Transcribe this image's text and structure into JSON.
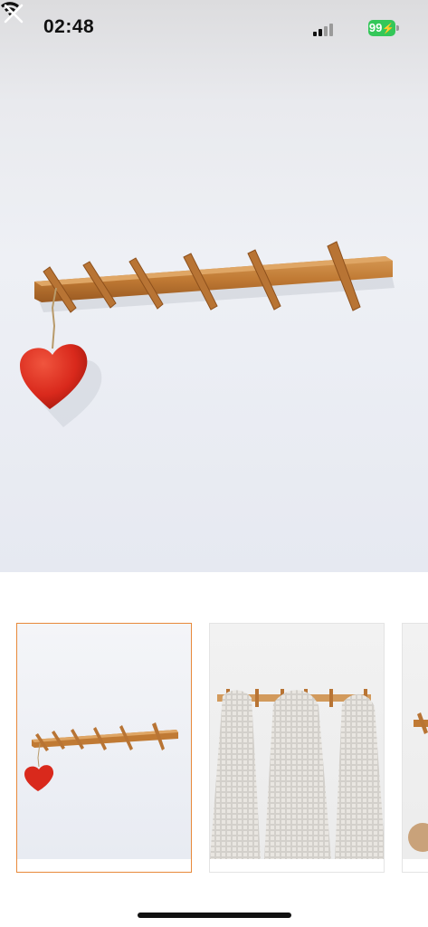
{
  "status_bar": {
    "time": "02:48",
    "battery": "99"
  },
  "icons": {
    "close": "close-icon",
    "signal": "cellular-signal-icon",
    "wifi": "wifi-icon",
    "battery": "battery-icon"
  },
  "gallery": {
    "main_image": "product-photo-1",
    "thumbnails": [
      {
        "id": "thumb-1",
        "selected": true
      },
      {
        "id": "thumb-2",
        "selected": false
      },
      {
        "id": "thumb-3",
        "selected": false
      }
    ]
  },
  "colors": {
    "selected_border": "#e8893a",
    "battery_green": "#34c759",
    "wood": "#c07a34",
    "heart": "#d9291c"
  }
}
